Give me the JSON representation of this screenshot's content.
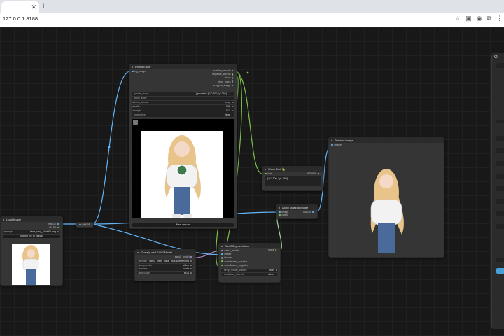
{
  "browser": {
    "url": "127.0.0.1:8188",
    "new_tab_symbol": "+",
    "close_tab_symbol": "✕",
    "toolbar_icons": [
      "star-icon",
      "extension-icon",
      "profile-icon",
      "extensions-puzzle-icon",
      "menu-icon"
    ]
  },
  "nodes": {
    "load_image": {
      "title": "Load Image",
      "outputs": [
        "IMAGE",
        "MASK"
      ],
      "image_label": "image",
      "image_value": "tase_resy_f4fab60.png",
      "upload_button": "choose file to upload"
    },
    "mini_reroute": {
      "label": "IMAGE"
    },
    "points_editor": {
      "title": "Points Editor",
      "input": "bg_image",
      "outputs": [
        "positive_coords",
        "negative_coords",
        "bbox",
        "bbox_mask",
        "cropped_image"
      ],
      "widgets": [
        {
          "label": "points_store",
          "value": "{\"positive\":[{\"x\":300,\"y\":266}]...}"
        },
        {
          "label": "bbox_store",
          "value": ""
        },
        {
          "label": "bbox_format",
          "value": "xyxy"
        },
        {
          "label": "width",
          "value": "512"
        },
        {
          "label": "height",
          "value": "512"
        },
        {
          "label": "normalize",
          "value": "false"
        }
      ],
      "button": "New canvas"
    },
    "show_text": {
      "title": "Show Text 🐍",
      "input": "text",
      "output": "STRING",
      "content": "[{\"x\": 300, \"y\": 266}]"
    },
    "apply_mask": {
      "title": "Apply Mask to Image",
      "inputs": [
        "image",
        "mask"
      ],
      "output": "IMAGE"
    },
    "preview_image": {
      "title": "Preview Image",
      "input": "images"
    },
    "downloadsam2": {
      "title": "(Down)Load SAM2Model",
      "output": "sam2_model",
      "widgets": [
        {
          "label": "model",
          "value": "sam2_hiera_base_plus.safetensors"
        },
        {
          "label": "segmentor",
          "value": "video"
        },
        {
          "label": "device",
          "value": "cuda"
        },
        {
          "label": "precision",
          "value": "bf16"
        }
      ]
    },
    "sam2_segmentation": {
      "title": "Sam2Segmentation",
      "inputs": [
        "sam2_model",
        "image",
        "bboxes",
        "coordinates_positive",
        "coordinates_negative"
      ],
      "output": "mask",
      "widgets": [
        {
          "label": "keep_model_loaded",
          "value": "true"
        },
        {
          "label": "individual_objects",
          "value": "false"
        }
      ]
    }
  },
  "right_panel": {
    "header": "Q"
  },
  "colors": {
    "canvas_bg": "#181818",
    "node_bg": "#353535",
    "link_image": "#64b5f6",
    "link_coords": "#7cbf4a",
    "link_mask": "#9fd3a0",
    "link_string": "#e0e0a0",
    "accent": "#4a9fd8"
  }
}
